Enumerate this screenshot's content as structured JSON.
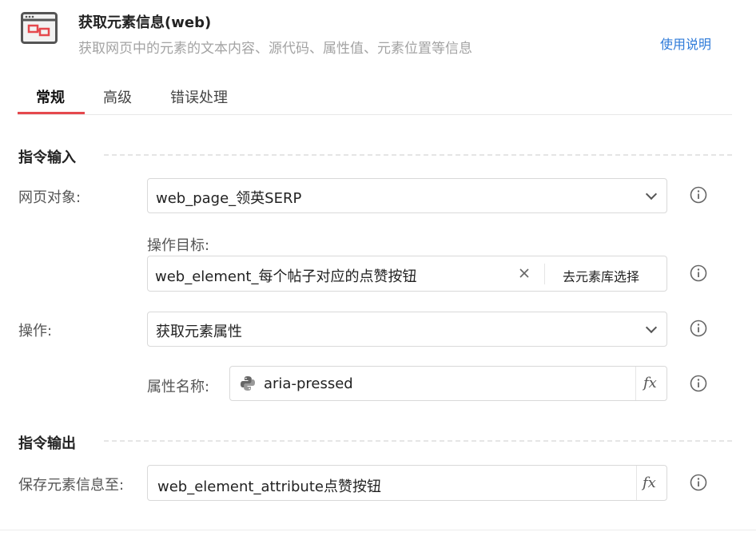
{
  "header": {
    "title": "获取元素信息(web)",
    "subtitle": "获取网页中的元素的文本内容、源代码、属性值、元素位置等信息",
    "help_link": "使用说明",
    "icon": "browser-element-icon"
  },
  "tabs": [
    {
      "label": "常规",
      "active": true
    },
    {
      "label": "高级",
      "active": false
    },
    {
      "label": "错误处理",
      "active": false
    }
  ],
  "sections": {
    "input_title": "指令输入",
    "output_title": "指令输出"
  },
  "fields": {
    "web_page": {
      "label": "网页对象:",
      "value": "web_page_领英SERP"
    },
    "target": {
      "label": "操作目标:",
      "value": "web_element_每个帖子对应的点赞按钮",
      "button": "去元素库选择"
    },
    "operation": {
      "label": "操作:",
      "value": "获取元素属性"
    },
    "attribute": {
      "label": "属性名称:",
      "value": "aria-pressed"
    },
    "save_to": {
      "label": "保存元素信息至:",
      "value": "web_element_attribute点赞按钮"
    }
  },
  "icons": {
    "info": "info-circle-icon",
    "fx": "fx-icon",
    "clear": "close-icon",
    "dropdown": "chevron-down-icon",
    "python": "python-icon"
  },
  "colors": {
    "accent": "#e5484d",
    "link": "#2f7bd9"
  }
}
